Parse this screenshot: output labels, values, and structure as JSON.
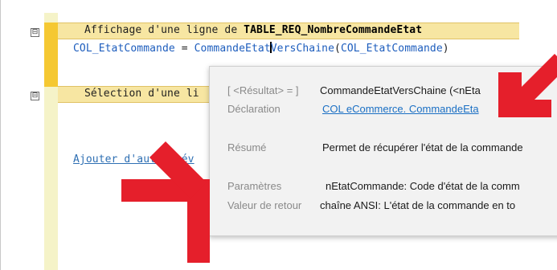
{
  "editor": {
    "fold_glyph": "⊟",
    "event_header_1": {
      "prefix": "Affichage d'une ligne de ",
      "table": "TABLE_REQ_NombreCommandeEtat"
    },
    "code_line": {
      "var": "COL_EtatCommande",
      "op": " = ",
      "func_a": "CommandeEtat",
      "func_b": "VersChaine",
      "paren_open": "(",
      "arg": "COL_EtatCommande",
      "paren_close": ")"
    },
    "event_header_2": "Sélection d'une li",
    "add_events_link": "Ajouter d'autres év"
  },
  "tooltip": {
    "result_label": "[ <Résultat> = ]",
    "result_value": "CommandeEtatVersChaine (<nEta",
    "declaration_label": "Déclaration",
    "declaration_value": "COL eCommerce. CommandeEta",
    "summary_label": "Résumé",
    "summary_value": "Permet de récupérer l'état de la commande",
    "params_label": "Paramètres",
    "params_value": "nEtatCommande: Code d'état de la comm",
    "return_label": "Valeur de retour",
    "return_value": "chaîne ANSI: L'état de la commande en to"
  },
  "colors": {
    "arrow": "#e51f2b",
    "event_band": "#f7e6a2",
    "event_tab": "#f5c832"
  },
  "icons": [
    "fold-minus-icon",
    "arrow-pointer-icon"
  ]
}
